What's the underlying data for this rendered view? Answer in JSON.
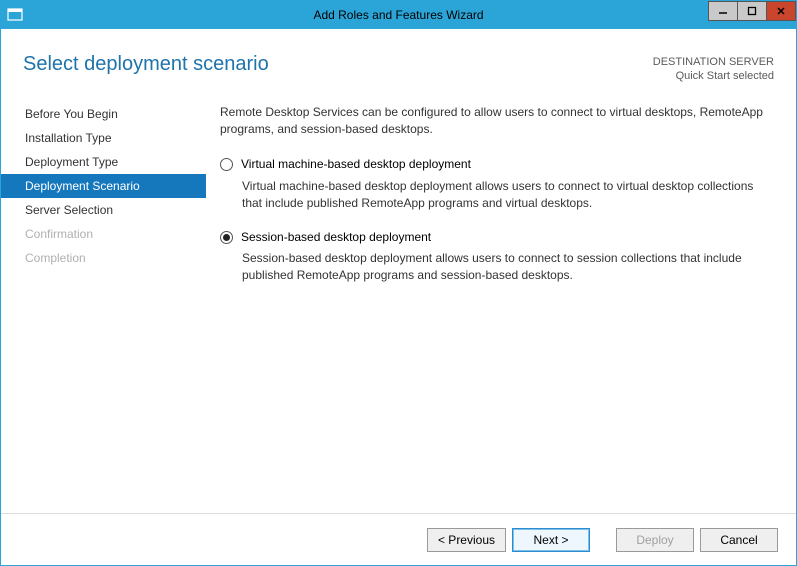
{
  "window": {
    "title": "Add Roles and Features Wizard"
  },
  "header": {
    "page_title": "Select deployment scenario",
    "destination_label": "DESTINATION SERVER",
    "destination_value": "Quick Start selected"
  },
  "sidebar": {
    "items": [
      {
        "label": "Before You Begin",
        "state": "normal"
      },
      {
        "label": "Installation Type",
        "state": "normal"
      },
      {
        "label": "Deployment Type",
        "state": "normal"
      },
      {
        "label": "Deployment Scenario",
        "state": "selected"
      },
      {
        "label": "Server Selection",
        "state": "normal"
      },
      {
        "label": "Confirmation",
        "state": "disabled"
      },
      {
        "label": "Completion",
        "state": "disabled"
      }
    ]
  },
  "content": {
    "intro": "Remote Desktop Services can be configured to allow users to connect to virtual desktops, RemoteApp programs, and session-based desktops.",
    "options": [
      {
        "id": "vm",
        "label": "Virtual machine-based desktop deployment",
        "description": "Virtual machine-based desktop deployment allows users to connect to virtual desktop collections that include published RemoteApp programs and virtual desktops.",
        "checked": false
      },
      {
        "id": "session",
        "label": "Session-based desktop deployment",
        "description": "Session-based desktop deployment allows users to connect to session collections that include published RemoteApp programs and session-based desktops.",
        "checked": true
      }
    ]
  },
  "footer": {
    "previous": "< Previous",
    "next": "Next >",
    "deploy": "Deploy",
    "cancel": "Cancel"
  }
}
